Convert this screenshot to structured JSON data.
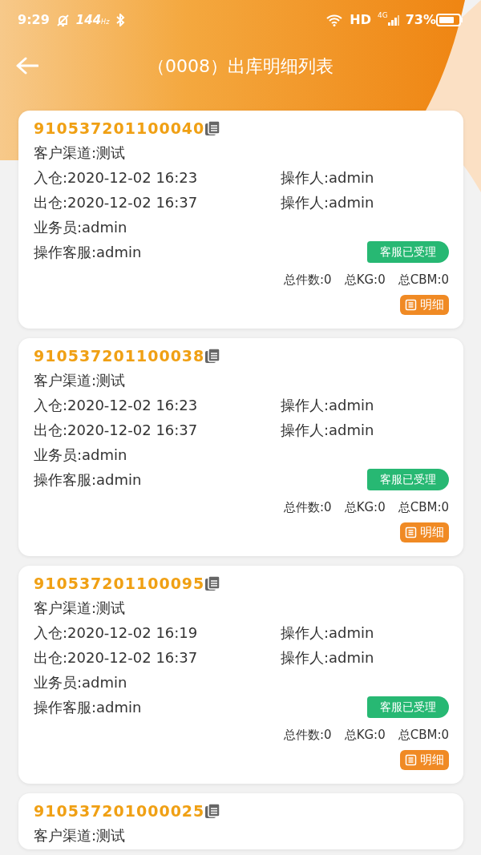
{
  "status_bar": {
    "time": "9:29",
    "refresh_rate": "144",
    "refresh_unit": "Hz",
    "hd": "HD",
    "network": "4G",
    "battery": "73%"
  },
  "header": {
    "title": "（0008）出库明细列表"
  },
  "cards": [
    {
      "number": "910537201100040",
      "channel": "客户渠道:测试",
      "rows": [
        {
          "left": "入仓:2020-12-02 16:23",
          "right": "操作人:admin"
        },
        {
          "left": "出仓:2020-12-02 16:37",
          "right": "操作人:admin"
        }
      ],
      "salesman": "业务员:admin",
      "service": "操作客服:admin",
      "status": "客服已受理",
      "totals": [
        "总件数:0",
        "总KG:0",
        "总CBM:0"
      ],
      "detail_button": "明细"
    },
    {
      "number": "910537201100038",
      "channel": "客户渠道:测试",
      "rows": [
        {
          "left": "入仓:2020-12-02 16:23",
          "right": "操作人:admin"
        },
        {
          "left": "出仓:2020-12-02 16:37",
          "right": "操作人:admin"
        }
      ],
      "salesman": "业务员:admin",
      "service": "操作客服:admin",
      "status": "客服已受理",
      "totals": [
        "总件数:0",
        "总KG:0",
        "总CBM:0"
      ],
      "detail_button": "明细"
    },
    {
      "number": "910537201100095",
      "channel": "客户渠道:测试",
      "rows": [
        {
          "left": "入仓:2020-12-02 16:19",
          "right": "操作人:admin"
        },
        {
          "left": "出仓:2020-12-02 16:37",
          "right": "操作人:admin"
        }
      ],
      "salesman": "业务员:admin",
      "service": "操作客服:admin",
      "status": "客服已受理",
      "totals": [
        "总件数:0",
        "总KG:0",
        "总CBM:0"
      ],
      "detail_button": "明细"
    },
    {
      "number": "910537201000025",
      "channel": "客户渠道:测试"
    }
  ]
}
